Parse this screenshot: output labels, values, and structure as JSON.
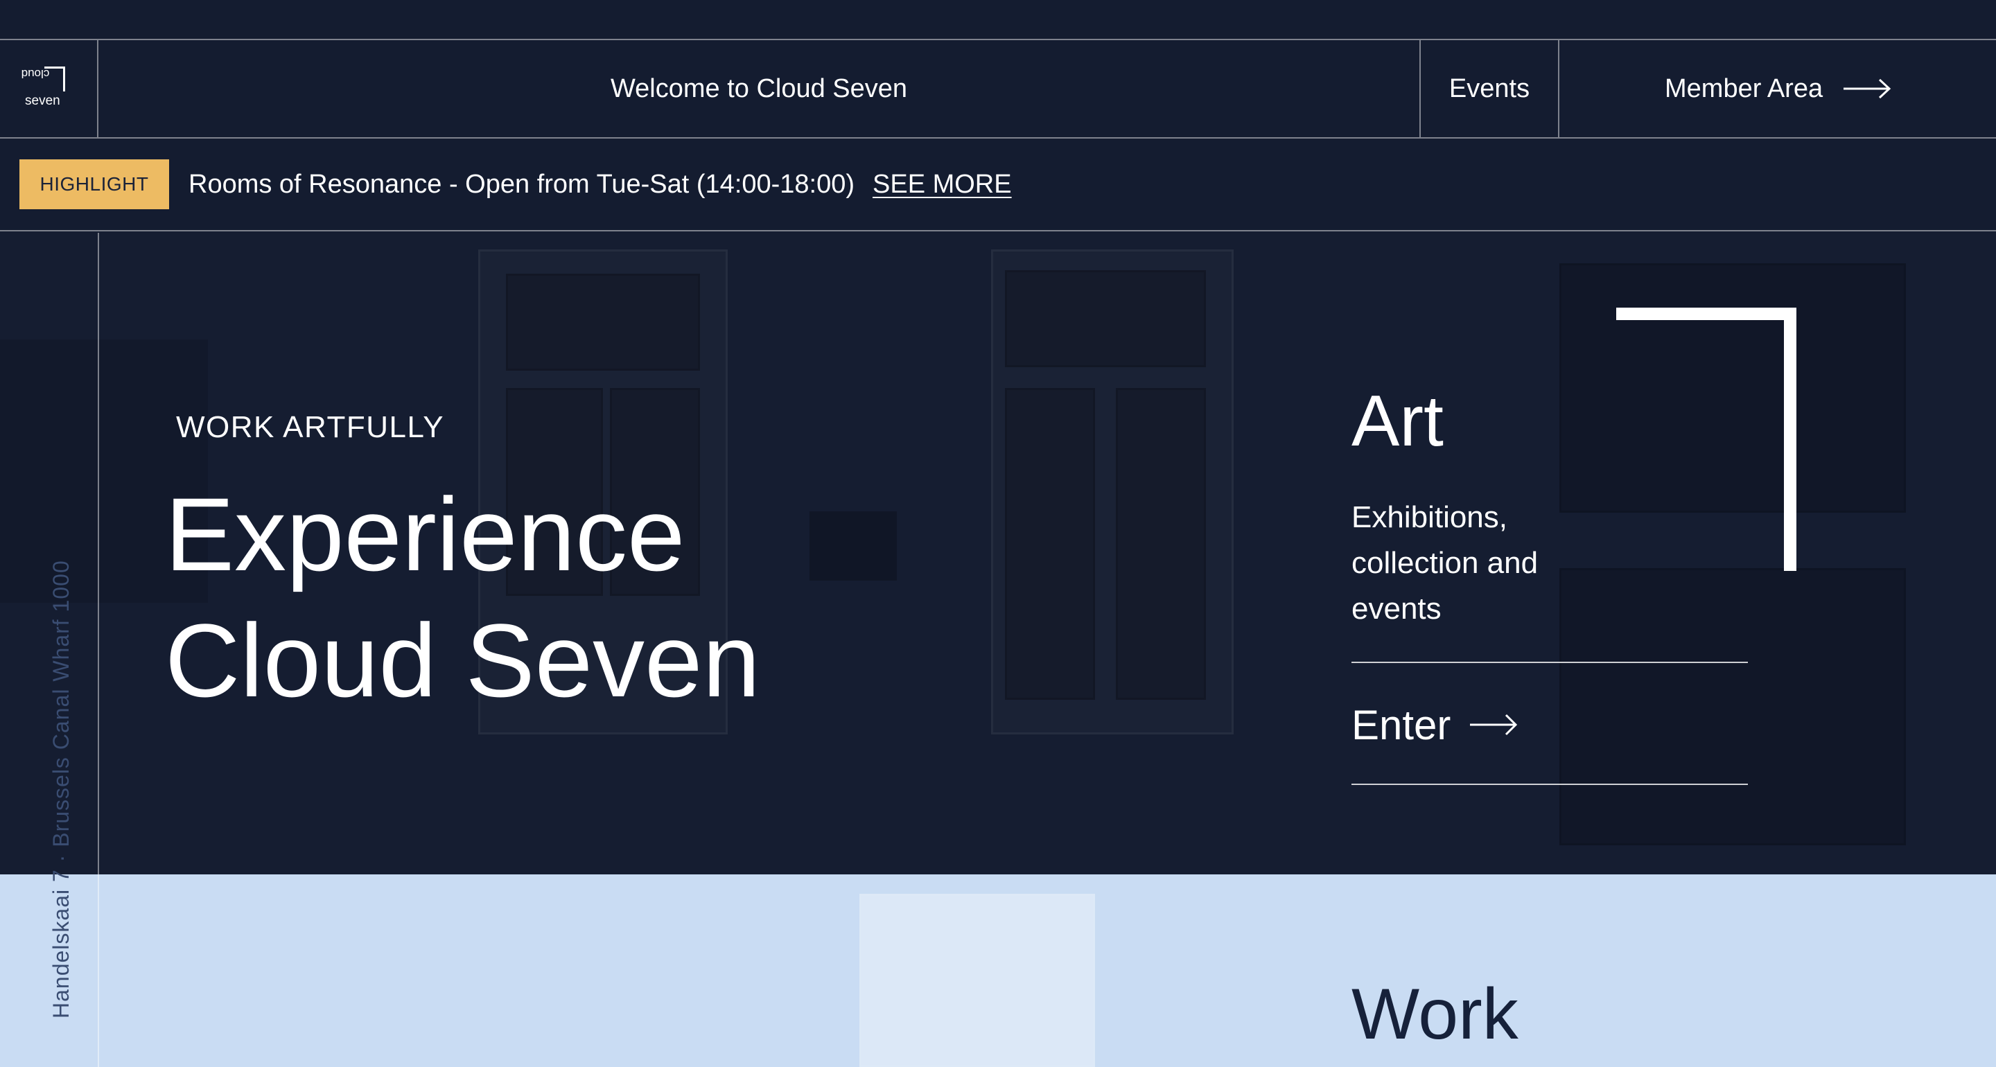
{
  "brand": {
    "logo_top": "cloud",
    "logo_bottom": "seven"
  },
  "header": {
    "welcome": "Welcome to Cloud Seven",
    "events_label": "Events",
    "member_label": "Member Area",
    "member_icon": "arrow-right-icon"
  },
  "highlight": {
    "badge": "HIGHLIGHT",
    "text": "Rooms of Resonance - Open from Tue-Sat (14:00-18:00)",
    "link": "SEE MORE"
  },
  "rail": {
    "address": "Handelskaai 7 · Brussels Canal Wharf 1000"
  },
  "hero": {
    "eyebrow": "WORK ARTFULLY",
    "title_line1": "Experience",
    "title_line2": "Cloud Seven"
  },
  "art_panel": {
    "title": "Art",
    "description": "Exhibitions, collection and events",
    "enter_label": "Enter",
    "enter_icon": "arrow-right-icon"
  },
  "work_panel": {
    "title": "Work"
  },
  "colors": {
    "navy": "#141c30",
    "highlight_badge": "#edbb63",
    "light_section": "#c9dcf3",
    "text_dark": "#16213a"
  }
}
